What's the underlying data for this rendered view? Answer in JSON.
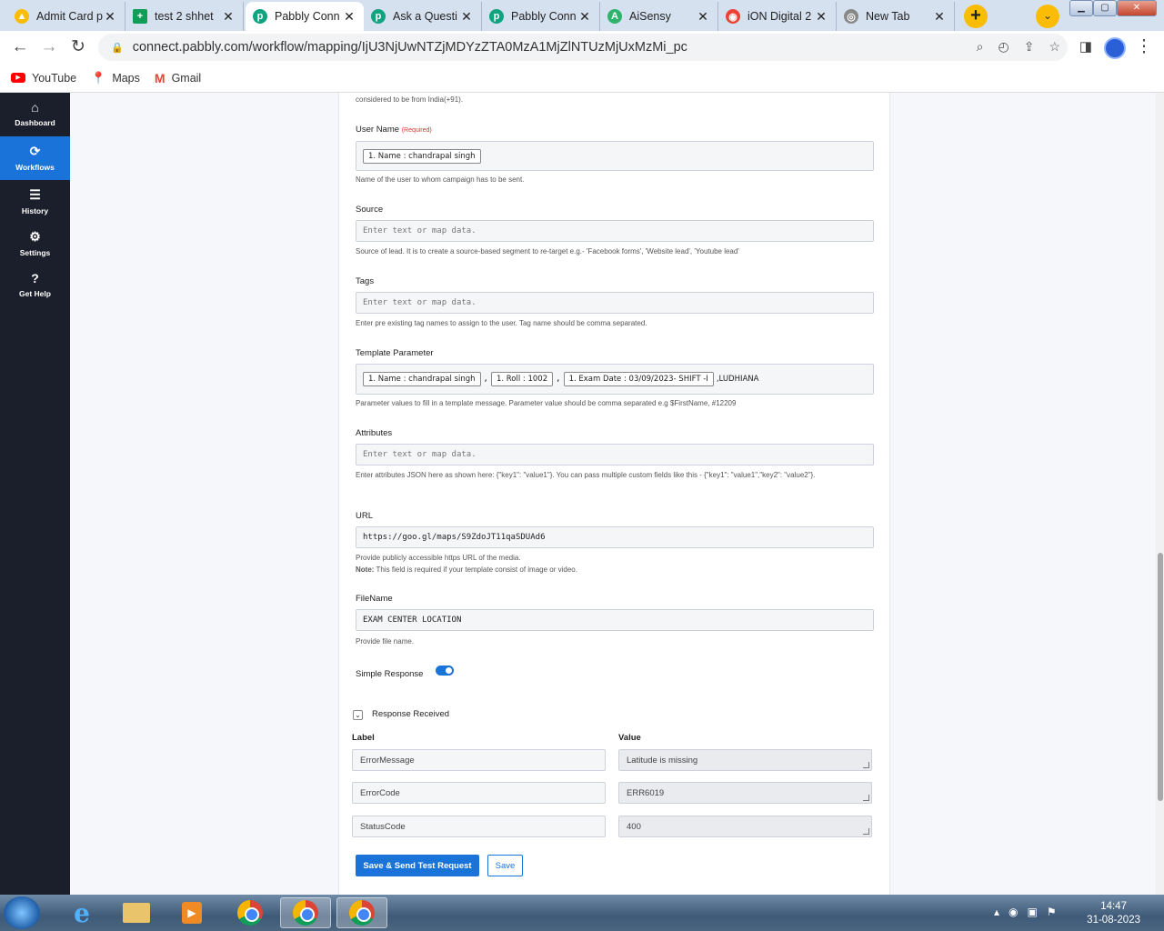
{
  "browser": {
    "tabs": [
      {
        "title": "Admit Card p",
        "color": "#fbbc05",
        "glyph": "▲"
      },
      {
        "title": "test 2 shhet",
        "color": "#0f9d58",
        "glyph": "+"
      },
      {
        "title": "Pabbly Conn",
        "color": "#10a37f",
        "glyph": "p"
      },
      {
        "title": "Ask a Questi",
        "color": "#10a37f",
        "glyph": "p"
      },
      {
        "title": "Pabbly Conn",
        "color": "#10a37f",
        "glyph": "p"
      },
      {
        "title": "AiSensy",
        "color": "#2db36b",
        "glyph": "A"
      },
      {
        "title": "iON Digital 2",
        "color": "#ea4335",
        "glyph": "◉"
      },
      {
        "title": "New Tab",
        "color": "#888888",
        "glyph": "◎"
      }
    ],
    "url": "connect.pabbly.com/workflow/mapping/IjU3NjUwNTZjMDYzZTA0MzA1MjZlNTUzMjUxMzMi_pc",
    "bookmarks": [
      {
        "label": "YouTube",
        "icon": "youtube-icon",
        "color": "#ff0000"
      },
      {
        "label": "Maps",
        "icon": "maps-icon",
        "color": "#34a853"
      },
      {
        "label": "Gmail",
        "icon": "gmail-icon",
        "color": "#ea4335"
      }
    ]
  },
  "sidebar": {
    "items": [
      {
        "label": "Dashboard",
        "icon": "home-icon"
      },
      {
        "label": "Workflows",
        "icon": "workflows-icon"
      },
      {
        "label": "History",
        "icon": "history-icon"
      },
      {
        "label": "Settings",
        "icon": "settings-icon"
      },
      {
        "label": "Get Help",
        "icon": "help-icon"
      }
    ]
  },
  "form": {
    "top_help": "considered to be from India(+91).",
    "user_name": {
      "label": "User Name",
      "required": "(Required)",
      "chip": "1. Name : chandrapal singh",
      "help": "Name of the user to whom campaign has to be sent."
    },
    "source": {
      "label": "Source",
      "placeholder": "Enter text or map data.",
      "help": "Source of lead. It is to create a source-based segment to re-target e.g.- 'Facebook forms', 'Website lead', 'Youtube lead'"
    },
    "tags": {
      "label": "Tags",
      "placeholder": "Enter text or map data.",
      "help": "Enter pre existing tag names to assign to the user. Tag name should be comma separated."
    },
    "template_parameter": {
      "label": "Template Parameter",
      "chips": [
        "1. Name : chandrapal singh",
        "1. Roll : 1002",
        "1. Exam Date : 03/09/2023- SHIFT -I"
      ],
      "separator": ",",
      "tail": ",LUDHIANA",
      "help": "Parameter values to fill in a template message. Parameter value should be comma separated e.g $FirstName, #12209"
    },
    "attributes": {
      "label": "Attributes",
      "placeholder": "Enter text or map data.",
      "help": "Enter attributes JSON here as shown here: {\"key1\": \"value1\"}. You can pass multiple custom fields like this - {\"key1\": \"value1\",\"key2\": \"value2\"}."
    },
    "url": {
      "label": "URL",
      "value": "https://goo.gl/maps/S9ZdoJT11qaSDUAd6",
      "help": "Provide publicly accessible https URL of the media.",
      "note_label": "Note:",
      "note": "This field is required if your template consist of image or video."
    },
    "filename": {
      "label": "FileName",
      "value": "EXAM CENTER LOCATION",
      "help": "Provide file name."
    },
    "simple_response": {
      "label": "Simple Response",
      "enabled": true
    },
    "response": {
      "title": "Response Received",
      "label_header": "Label",
      "value_header": "Value",
      "rows": [
        {
          "label": "ErrorMessage",
          "value": "Latitude is missing"
        },
        {
          "label": "ErrorCode",
          "value": "ERR6019"
        },
        {
          "label": "StatusCode",
          "value": "400"
        }
      ]
    },
    "buttons": {
      "save_send": "Save & Send Test Request",
      "save": "Save"
    }
  },
  "taskbar": {
    "time": "14:47",
    "date": "31-08-2023"
  },
  "colors": {
    "primary": "#1a73d9",
    "sidebar": "#1b1e2b"
  }
}
